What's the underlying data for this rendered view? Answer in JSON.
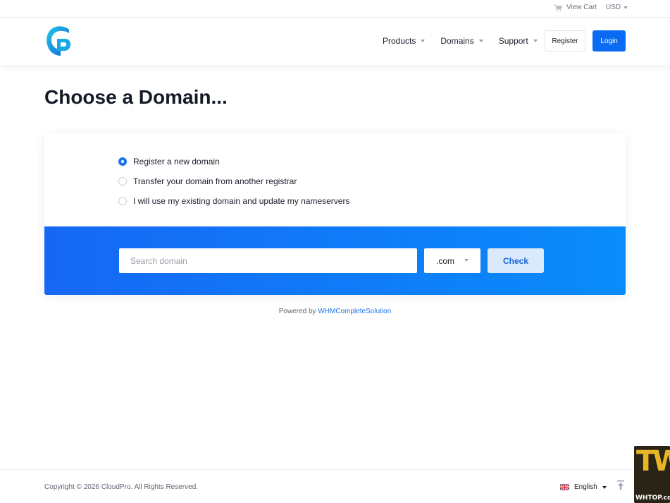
{
  "topbar": {
    "cart_label": "View Cart",
    "currency": "USD"
  },
  "header": {
    "nav": [
      {
        "label": "Products"
      },
      {
        "label": "Domains"
      },
      {
        "label": "Support"
      }
    ],
    "register_label": "Register",
    "login_label": "Login"
  },
  "page": {
    "title": "Choose a Domain..."
  },
  "domain_options": [
    {
      "label": "Register a new domain",
      "checked": true
    },
    {
      "label": "Transfer your domain from another registrar",
      "checked": false
    },
    {
      "label": "I will use my existing domain and update my nameservers",
      "checked": false
    }
  ],
  "search": {
    "placeholder": "Search domain",
    "tld": ".com",
    "check_label": "Check"
  },
  "powered": {
    "prefix": "Powered by",
    "link": "WHMCompleteSolution"
  },
  "footer": {
    "copyright": "Copyright © 2026 CloudPro. All Rights Reserved.",
    "language": "English"
  },
  "watermark": {
    "logo_text": "TW",
    "site": "WHTOP.com"
  },
  "colors": {
    "brand_blue": "#0b6bf5",
    "band_start": "#1668f4",
    "band_end": "#0a8cfb"
  }
}
